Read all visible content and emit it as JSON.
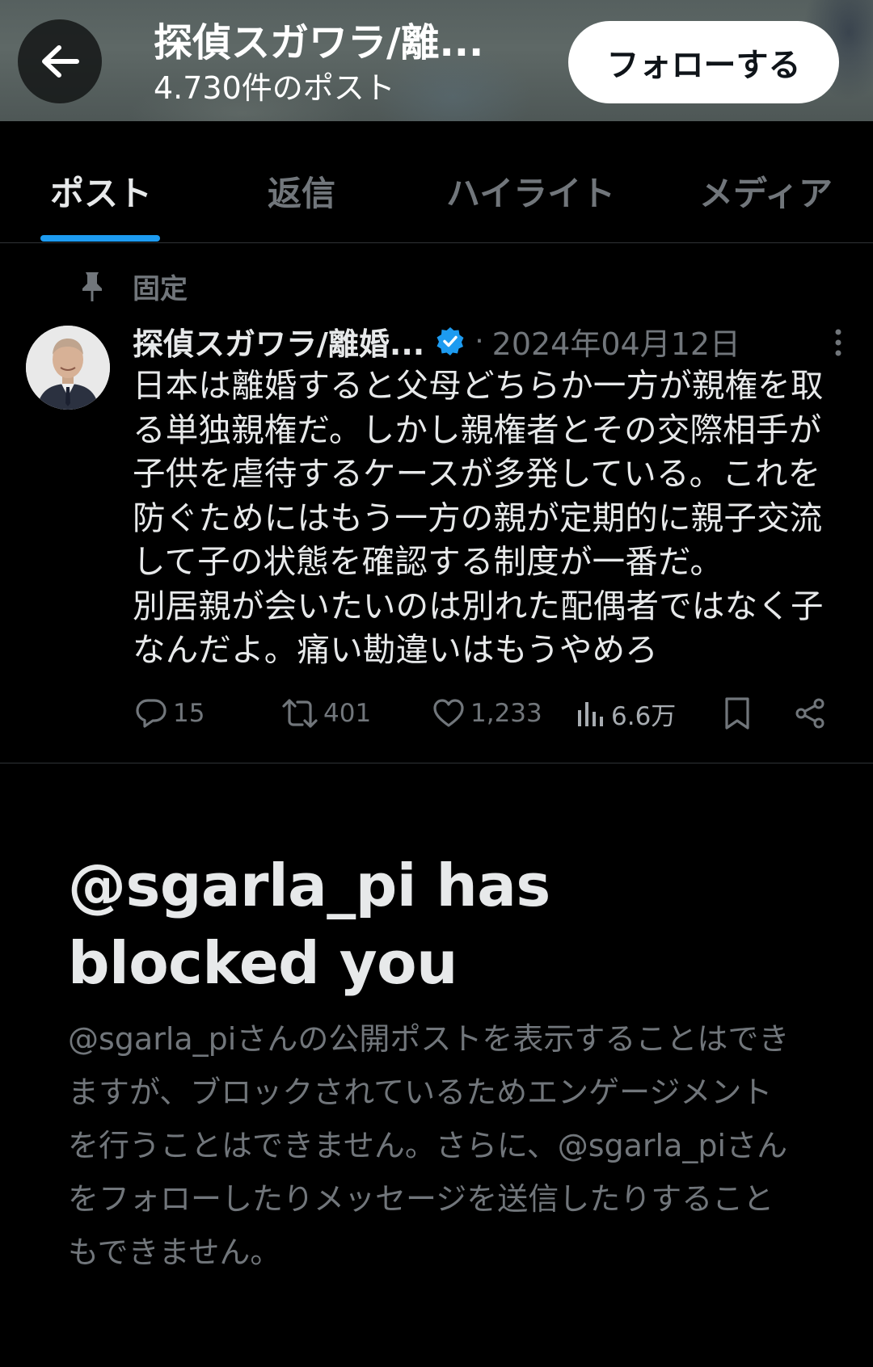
{
  "header": {
    "profile_name": "探偵スガワラ/離...",
    "post_count": "4.730件のポスト",
    "follow_label": "フォローする"
  },
  "tabs": [
    {
      "label": "ポスト",
      "active": true
    },
    {
      "label": "返信",
      "active": false
    },
    {
      "label": "ハイライト",
      "active": false
    },
    {
      "label": "メディア",
      "active": false
    }
  ],
  "pinned": {
    "label": "固定"
  },
  "tweet": {
    "author": "探偵スガワラ/離婚...",
    "separator": "·",
    "date": "2024年04月12日",
    "text": "日本は離婚すると父母どちらか一方が親権を取\nる単独親権だ。しかし親権者とその交際相手が\n子供を虐待するケースが多発している。これを\n防ぐためにはもう一方の親が定期的に親子交流\nして子の状態を確認する制度が一番だ。\n別居親が会いたいのは別れた配偶者ではなく子\nなんだよ。痛い勘違いはもうやめろ",
    "replies": "15",
    "reposts": "401",
    "likes": "1,233",
    "views": "6.6万"
  },
  "blocked": {
    "title": "@sgarla_pi has blocked you",
    "description": "@sgarla_piさんの公開ポストを表示することはできますが、ブロックされているためエンゲージメントを行うことはできません。さらに、@sgarla_piさんをフォローしたりメッセージを送信したりすることもできません。"
  },
  "colors": {
    "accent": "#1d9bf0",
    "muted": "#71767b",
    "text": "#e7e9ea",
    "background": "#000000"
  },
  "icons": [
    "back-arrow-icon",
    "pin-icon",
    "verified-badge-icon",
    "more-options-icon",
    "reply-icon",
    "repost-icon",
    "like-icon",
    "views-icon",
    "bookmark-icon",
    "share-icon"
  ]
}
